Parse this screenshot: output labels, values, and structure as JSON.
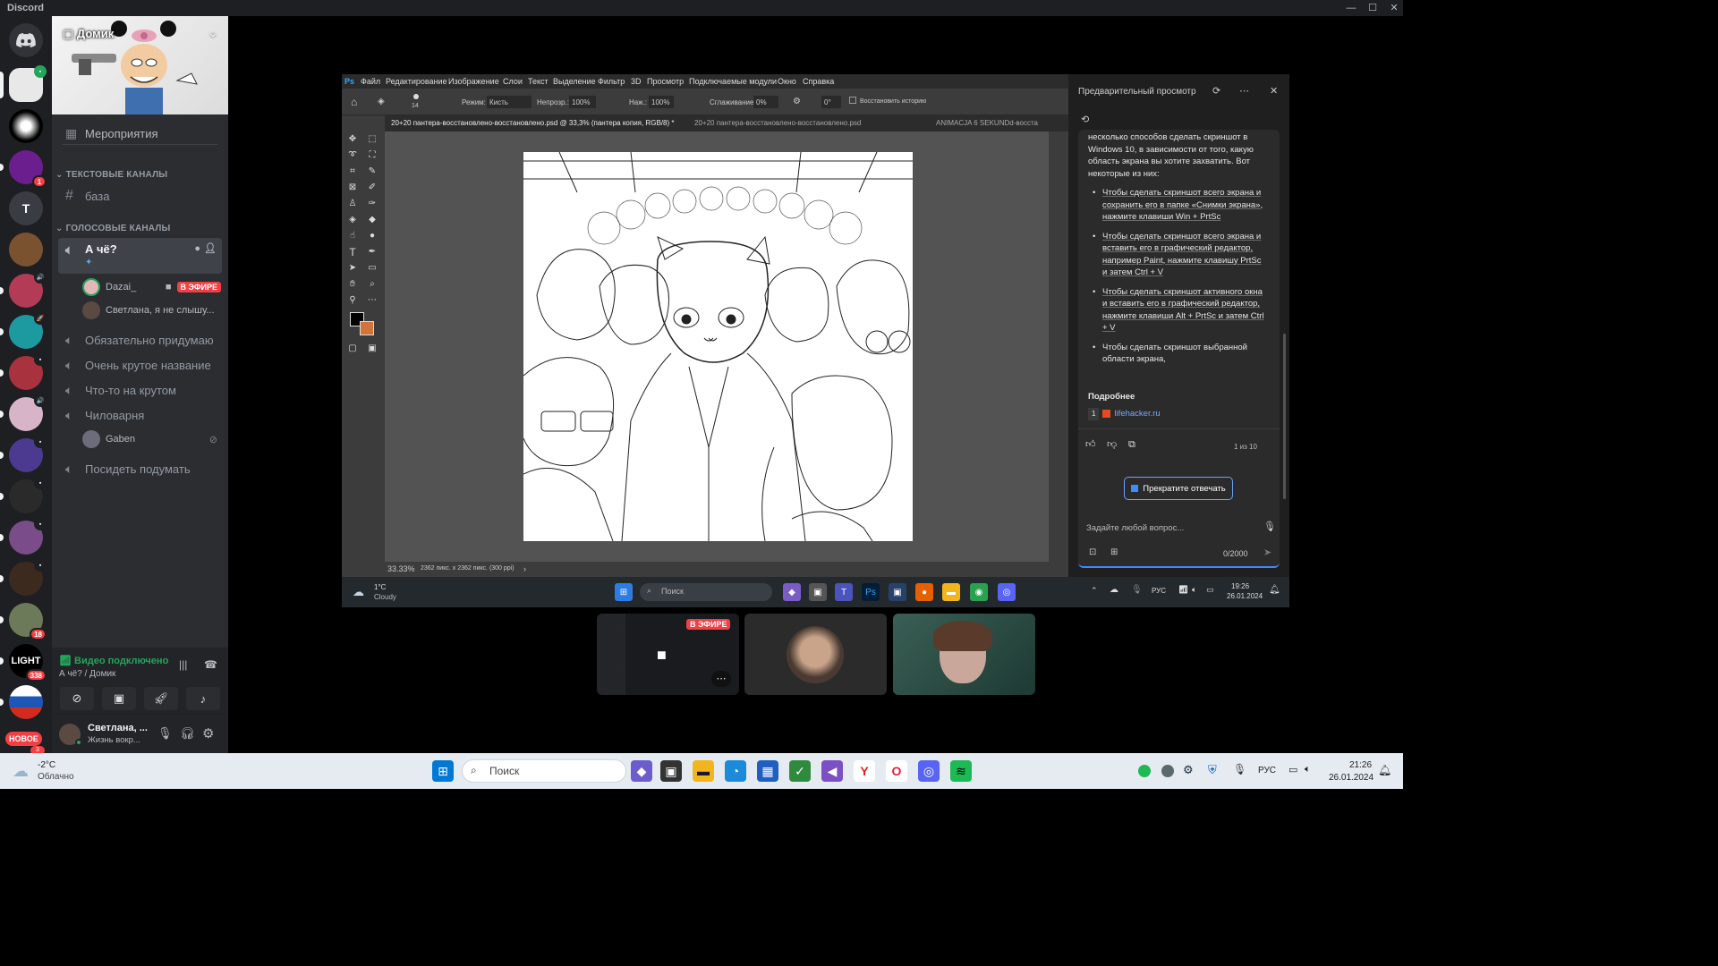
{
  "window": {
    "title": "Discord"
  },
  "servers": {
    "t_letter": "T",
    "light_label": "LIGHT",
    "badges": [
      "1",
      "18",
      "338",
      "3"
    ],
    "new_badge": "НОВОЕ"
  },
  "guild": {
    "name": "Домик"
  },
  "channels": {
    "events": "Мероприятия",
    "text_category": "ТЕКСТОВЫЕ КАНАЛЫ",
    "text_channel": "база",
    "voice_category": "ГОЛОСОВЫЕ КАНАЛЫ",
    "active_voice": "А чё?",
    "voice_users": [
      {
        "name": "Dazai_",
        "live": "В ЭФИРЕ"
      },
      {
        "name": "Светлана, я не слышу..."
      }
    ],
    "other_voice": [
      "Обязательно придумаю",
      "Очень крутое название",
      "Что-то на крутом",
      "Чиловарня"
    ],
    "chillroom_user": "Gaben",
    "last_voice": "Посидеть подумать"
  },
  "voice_status": {
    "state": "Видео подключено",
    "location": "А чё? / Домик"
  },
  "user": {
    "name": "Светлана, ...",
    "status": "Жизнь вокр..."
  },
  "photoshop": {
    "menu": [
      "Файл",
      "Редактирование",
      "Изображение",
      "Слои",
      "Текст",
      "Выделение",
      "Фильтр",
      "3D",
      "Просмотр",
      "Подключаемые модули",
      "Окно",
      "Справка"
    ],
    "options": {
      "brush_size": "14",
      "mode_label": "Режим:",
      "mode": "Кисть",
      "opacity_label": "Непрозр.:",
      "opacity": "100%",
      "pressure_label": "Наж.:",
      "pressure": "100%",
      "smoothing_label": "Сглаживание:",
      "smoothing": "0%",
      "angle": "0°",
      "restore_history": "Восстановить историю"
    },
    "tabs": [
      "20+20 пантера-восстановлено-восстановлено.psd @ 33,3% (пантера копия, RGB/8) *",
      "20+20 пантера-восстановлено-восстановлено.psd",
      "ANIMACJA 6 SEKUNDd-восста"
    ],
    "status_zoom": "33.33%",
    "status_info": "2362 пикс. x 2362 пикс. (300 ppi)"
  },
  "copilot": {
    "header": "Предварительный просмотр",
    "intro": "несколько способов сделать скриншот в Windows 10, в зависимости от того, какую область экрана вы хотите захватить. Вот некоторые из них:",
    "bullets": [
      "Чтобы сделать скриншот всего экрана и сохранить его в папке «Снимки экрана», нажмите клавиши Win + PrtSc",
      "Чтобы сделать скриншот всего экрана и вставить его в графический редактор, например Paint, нажмите клавишу PrtSc и затем Ctrl + V",
      "Чтобы сделать скриншот активного окна и вставить его в графический редактор, нажмите клавиши Alt + PrtSc и затем Ctrl + V",
      "Чтобы сделать скриншот выбранной области экрана,"
    ],
    "more_label": "Подробнее",
    "source_num": "1",
    "source": "lifehacker.ru",
    "pager": "1 из 10",
    "stop_button": "Прекратите отвечать",
    "input_placeholder": "Задайте любой вопрос...",
    "char_count": "0/2000"
  },
  "inner_taskbar": {
    "temp": "1°C",
    "weather": "Cloudy",
    "search": "Поиск",
    "lang": "РУС",
    "time": "19:26",
    "date": "26.01.2024"
  },
  "stream_tiles": {
    "live_label": "В ЭФИРЕ"
  },
  "taskbar": {
    "temp": "-2°C",
    "weather": "Облачно",
    "search": "Поиск",
    "lang": "РУС",
    "time": "21:26",
    "date": "26.01.2024"
  },
  "colors": {
    "discord_bg": "#1e1f22",
    "channels_bg": "#2b2d31",
    "green": "#23a55a",
    "red": "#f23f43",
    "accent": "#5865f2"
  }
}
